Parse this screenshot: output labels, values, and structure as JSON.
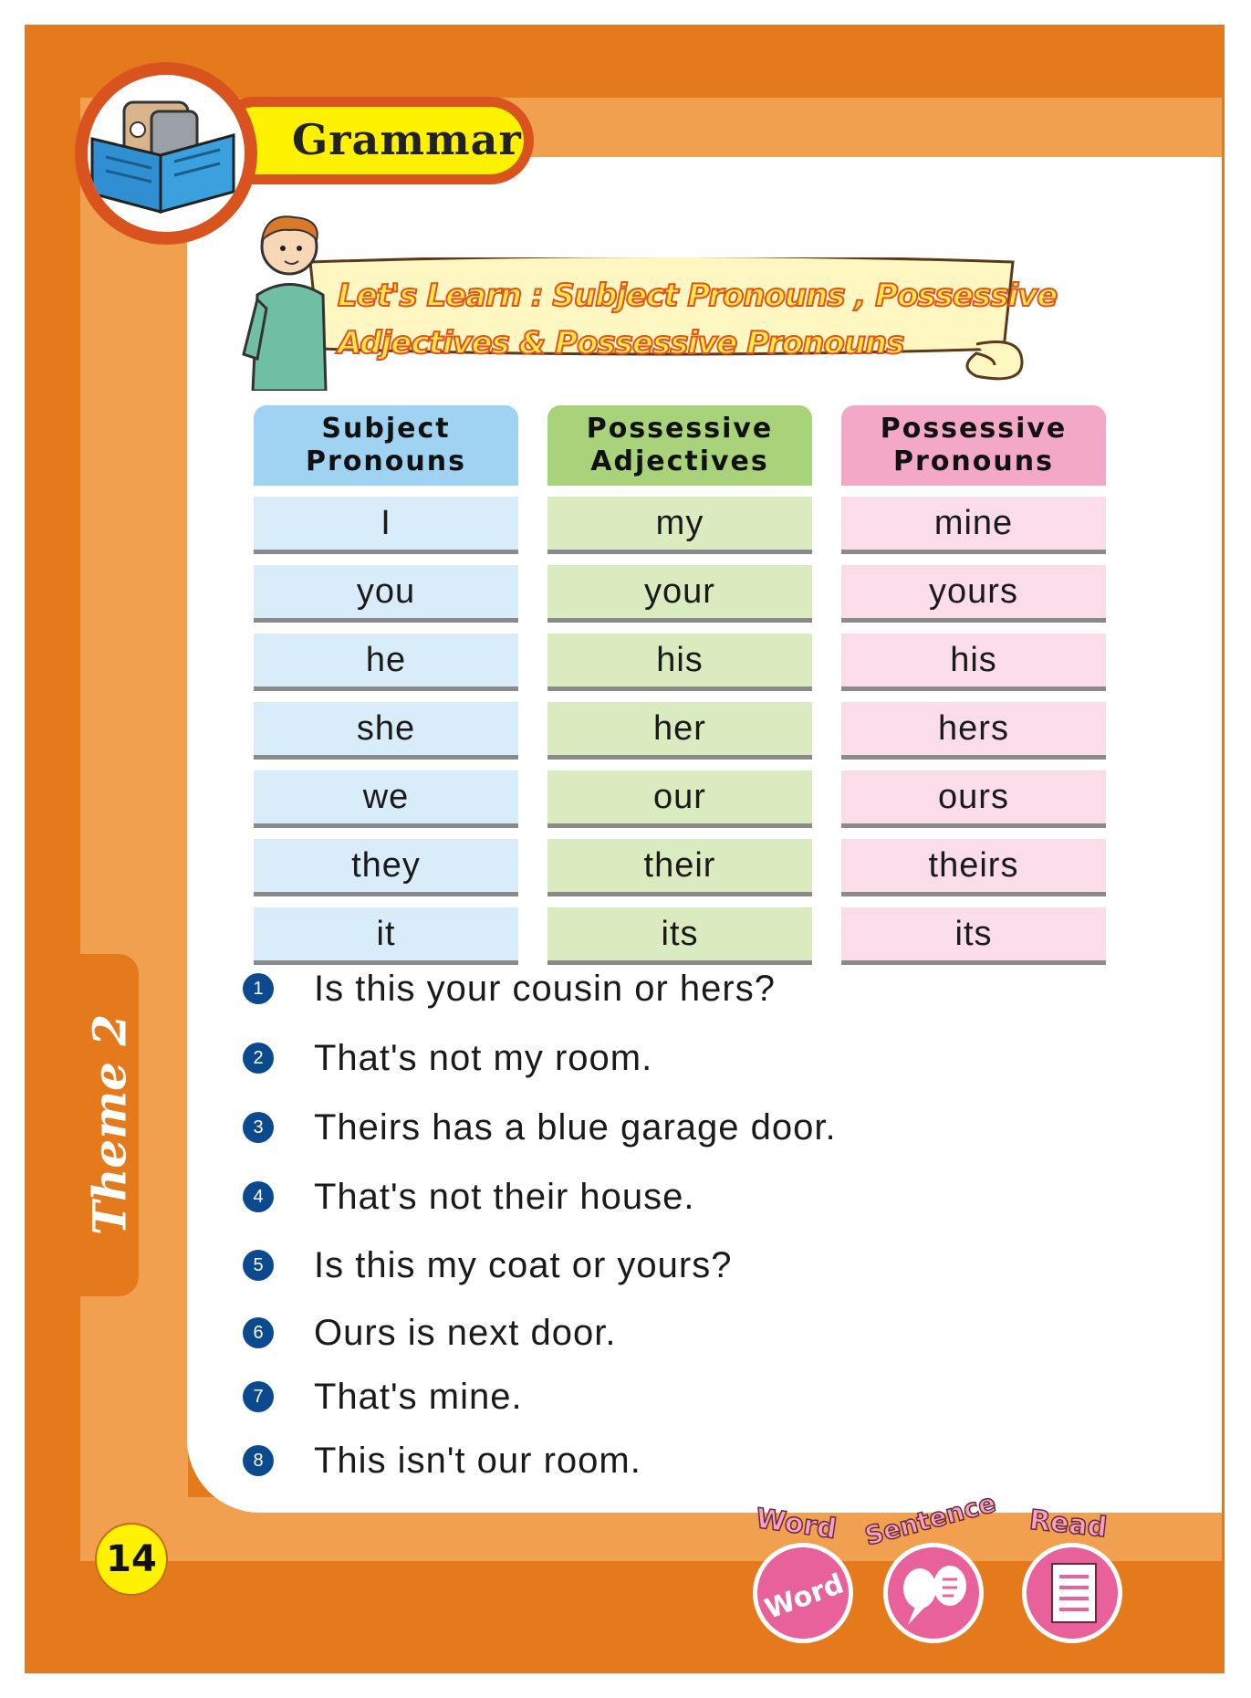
{
  "header": {
    "section": "Grammar"
  },
  "lesson": {
    "title_line1": "Let's Learn : Subject Pronouns , Possessive",
    "title_line2": "Adjectives & Possessive Pronouns"
  },
  "table": {
    "columns": [
      {
        "header_line1": "Subject",
        "header_line2": "Pronouns",
        "rows": [
          "I",
          "you",
          "he",
          "she",
          "we",
          "they",
          "it"
        ]
      },
      {
        "header_line1": "Possessive",
        "header_line2": "Adjectives",
        "rows": [
          "my",
          "your",
          "his",
          "her",
          "our",
          "their",
          "its"
        ]
      },
      {
        "header_line1": "Possessive",
        "header_line2": "Pronouns",
        "rows": [
          "mine",
          "yours",
          "his",
          "hers",
          "ours",
          "theirs",
          "its"
        ]
      }
    ]
  },
  "sentences": [
    {
      "num": "1",
      "text": "Is this your cousin or hers?"
    },
    {
      "num": "2",
      "text": "That's not my room."
    },
    {
      "num": "3",
      "text": "Theirs has a blue garage door."
    },
    {
      "num": "4",
      "text": "That's not their house."
    },
    {
      "num": "5",
      "text": "Is this my coat or yours?"
    },
    {
      "num": "6",
      "text": "Ours is next door."
    },
    {
      "num": "7",
      "text": "That's mine."
    },
    {
      "num": "8",
      "text": "This isn't our room."
    }
  ],
  "side_tab": {
    "label": "Theme 2"
  },
  "footer": {
    "page_number": "14",
    "icons": [
      {
        "label": "Word",
        "inner": "Word",
        "icon": "word-icon"
      },
      {
        "label": "Sentence",
        "icon": "speech-bubbles-icon"
      },
      {
        "label": "Read",
        "icon": "document-icon"
      }
    ]
  },
  "colors": {
    "orange": "#e57a1c",
    "light_orange": "#f0a04e",
    "yellow": "#fff200",
    "blue_head": "#9fd3f1",
    "green_head": "#a8d37a",
    "pink_head": "#f3a8c8",
    "number_badge": "#0b4a8f",
    "icon_pink": "#e9619a"
  }
}
